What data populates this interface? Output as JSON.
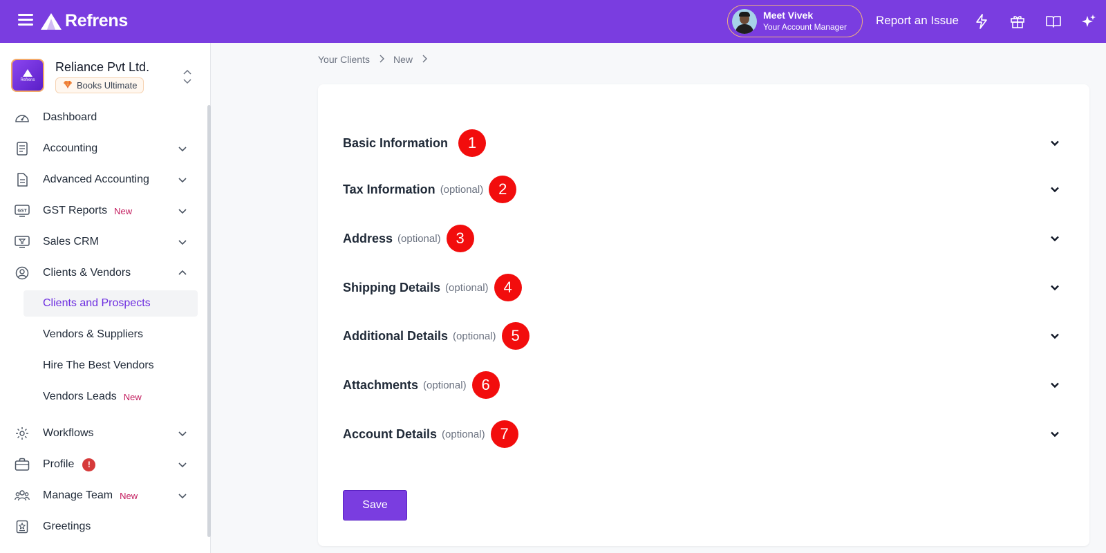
{
  "topbar": {
    "brand": "Refrens",
    "manager_name": "Meet Vivek",
    "manager_role": "Your Account Manager",
    "report_label": "Report an Issue",
    "icons": [
      "lightning-icon",
      "gift-icon",
      "book-icon",
      "sparkle-icon"
    ]
  },
  "org": {
    "name": "Reliance Pvt Ltd.",
    "plan": "Books Ultimate",
    "logo_text": "Refrens"
  },
  "sidebar": {
    "items": [
      {
        "label": "Dashboard"
      },
      {
        "label": "Accounting"
      },
      {
        "label": "Advanced Accounting"
      },
      {
        "label": "GST Reports",
        "badge": "New"
      },
      {
        "label": "Sales CRM"
      },
      {
        "label": "Clients & Vendors"
      },
      {
        "label": "Workflows"
      },
      {
        "label": "Profile",
        "alert": "!"
      },
      {
        "label": "Manage Team",
        "badge": "New"
      },
      {
        "label": "Greetings"
      }
    ],
    "sub_items": [
      {
        "label": "Clients and Prospects",
        "active": true
      },
      {
        "label": "Vendors & Suppliers"
      },
      {
        "label": "Hire The Best Vendors"
      },
      {
        "label": "Vendors Leads",
        "badge": "New"
      }
    ]
  },
  "breadcrumb": {
    "items": [
      "Your Clients",
      "New"
    ]
  },
  "form": {
    "sections": [
      {
        "title": "Basic Information",
        "optional": "",
        "marker": "1"
      },
      {
        "title": "Tax Information",
        "optional": "(optional)",
        "marker": "2"
      },
      {
        "title": "Address",
        "optional": "(optional)",
        "marker": "3"
      },
      {
        "title": "Shipping Details",
        "optional": "(optional)",
        "marker": "4"
      },
      {
        "title": "Additional Details",
        "optional": "(optional)",
        "marker": "5"
      },
      {
        "title": "Attachments",
        "optional": "(optional)",
        "marker": "6"
      },
      {
        "title": "Account Details",
        "optional": "(optional)",
        "marker": "7"
      }
    ],
    "save_label": "Save"
  },
  "colors": {
    "brand": "#7a3de0",
    "marker": "#f20d0d",
    "active_text": "#6d2ee0",
    "new_badge": "#c2185b"
  }
}
